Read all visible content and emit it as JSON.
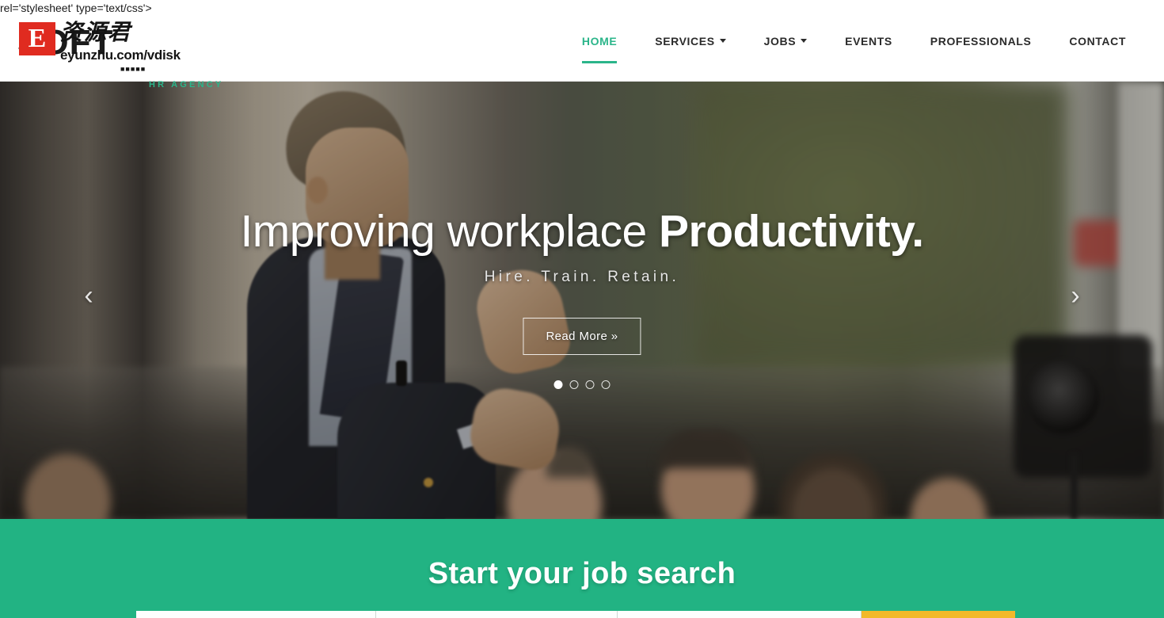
{
  "page": {
    "leaked_markup_text": "rel='stylesheet' type='text/css'>",
    "accent_green": "#22b383",
    "nav_active_color": "#2bb58a",
    "button_yellow": "#f2b92a"
  },
  "watermark": {
    "badge_letter": "E",
    "chinese": "资源君",
    "url": "eyunzhu.com/vdisk",
    "dots": "■■■■■"
  },
  "header": {
    "logo": {
      "name": "SOFT",
      "tagline": "HR AGENCY"
    },
    "nav": [
      {
        "label": "HOME",
        "active": true,
        "has_dropdown": false
      },
      {
        "label": "SERVICES",
        "active": false,
        "has_dropdown": true
      },
      {
        "label": "JOBS",
        "active": false,
        "has_dropdown": true
      },
      {
        "label": "EVENTS",
        "active": false,
        "has_dropdown": false
      },
      {
        "label": "PROFESSIONALS",
        "active": false,
        "has_dropdown": false
      },
      {
        "label": "CONTACT",
        "active": false,
        "has_dropdown": false
      }
    ]
  },
  "hero": {
    "title_light": "Improving workplace ",
    "title_bold": "Productivity.",
    "subtitle": "Hire. Train. Retain.",
    "cta_label": "Read More »",
    "prev_arrow": "‹",
    "next_arrow": "›",
    "slide_count": 4,
    "active_slide": 1
  },
  "search_section": {
    "heading": "Start your job search",
    "fields": [
      {
        "placeholder": "",
        "value": ""
      },
      {
        "placeholder": "",
        "value": ""
      },
      {
        "placeholder": "",
        "value": ""
      }
    ],
    "submit_label": ""
  }
}
